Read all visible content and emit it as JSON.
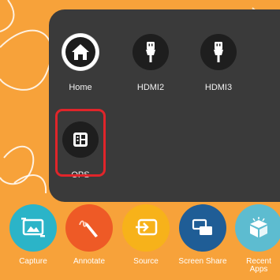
{
  "source_menu": {
    "items": [
      {
        "label": "Home",
        "icon": "home-icon"
      },
      {
        "label": "HDMI2",
        "icon": "hdmi-icon"
      },
      {
        "label": "HDMI3",
        "icon": "hdmi-icon"
      },
      {
        "label": "OPS",
        "icon": "ops-icon"
      }
    ],
    "selected": "OPS"
  },
  "dock": {
    "items": [
      {
        "label": "Capture",
        "icon": "capture-icon",
        "color": "#2bb4c8"
      },
      {
        "label": "Annotate",
        "icon": "annotate-icon",
        "color": "#ee5a26"
      },
      {
        "label": "Source",
        "icon": "source-icon",
        "color": "#f7b21a"
      },
      {
        "label": "Screen Share",
        "icon": "screen-share-icon",
        "color": "#1f5d96"
      },
      {
        "label": "Recent Apps",
        "icon": "recent-apps-icon",
        "color": "#5dbcd0"
      }
    ]
  },
  "colors": {
    "background": "#f7a23a",
    "panel": "#3a3a3a",
    "selection_border": "#e0252a"
  }
}
